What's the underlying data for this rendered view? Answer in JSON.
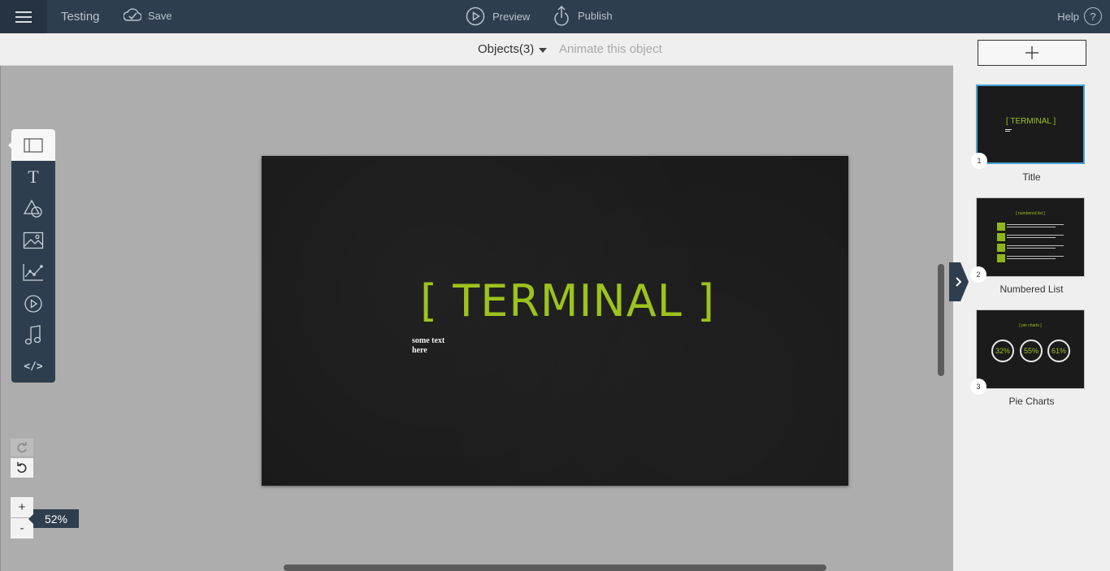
{
  "topbar": {
    "doc_title": "Testing",
    "save_label": "Save",
    "preview_label": "Preview",
    "publish_label": "Publish",
    "help_label": "Help",
    "help_symbol": "?"
  },
  "object_bar": {
    "objects_label": "Objects(3)",
    "animate_label": "Animate this object"
  },
  "tools": [
    {
      "icon": "layout-icon",
      "active": true
    },
    {
      "icon": "text-icon",
      "glyph": "T"
    },
    {
      "icon": "shapes-icon"
    },
    {
      "icon": "image-icon"
    },
    {
      "icon": "chart-icon"
    },
    {
      "icon": "video-icon"
    },
    {
      "icon": "audio-icon"
    },
    {
      "icon": "code-icon",
      "glyph": "</>"
    }
  ],
  "slide": {
    "title": "[ TERMINAL ]",
    "subtitle": "some text here"
  },
  "zoom": {
    "plus": "+",
    "minus": "-",
    "level": "52%"
  },
  "slides_panel": {
    "thumbnails": [
      {
        "number": "1",
        "label": "Title",
        "title": "[ TERMINAL ]",
        "selected": true
      },
      {
        "number": "2",
        "label": "Numbered List",
        "title": "[ numbered list ]"
      },
      {
        "number": "3",
        "label": "Pie Charts",
        "title": "[ pie charts ]",
        "pies": [
          "32%",
          "55%",
          "61%"
        ]
      }
    ]
  },
  "colors": {
    "topbar": "#2f3e4e",
    "accent_green": "#9dc31c",
    "selection_blue": "#4ba3d6",
    "slide_bg": "#1a1a1a"
  }
}
